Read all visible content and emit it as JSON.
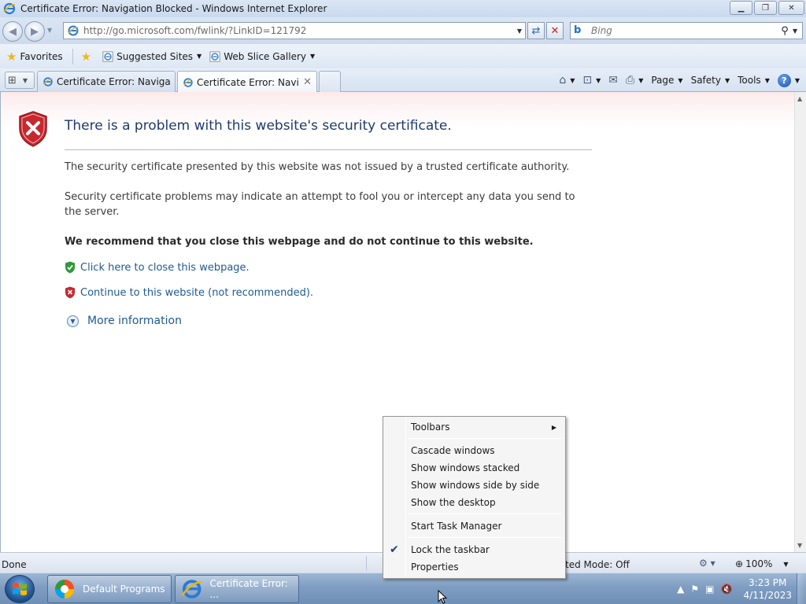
{
  "window": {
    "title": "Certificate Error: Navigation Blocked - Windows Internet Explorer"
  },
  "address_bar": {
    "url": "http://go.microsoft.com/fwlink/?LinkID=121792"
  },
  "search": {
    "placeholder": "Bing"
  },
  "favorites_bar": {
    "favorites_label": "Favorites",
    "suggested_sites": "Suggested Sites",
    "web_slice_gallery": "Web Slice Gallery"
  },
  "tabs": [
    {
      "label": "Certificate Error: Navigatio..."
    },
    {
      "label": "Certificate Error: Navig..."
    }
  ],
  "command_bar": {
    "page": "Page",
    "safety": "Safety",
    "tools": "Tools"
  },
  "page": {
    "heading": "There is a problem with this website's security certificate.",
    "para1": "The security certificate presented by this website was not issued by a trusted certificate authority.",
    "para2": "Security certificate problems may indicate an attempt to fool you or intercept any data you send to the server.",
    "recommend": "We recommend that you close this webpage and do not continue to this website.",
    "close_link": "Click here to close this webpage.",
    "continue_link": "Continue to this website (not recommended).",
    "more_info": "More information"
  },
  "status_bar": {
    "status": "Done",
    "protected_mode": "ted Mode: Off",
    "zoom": "100%"
  },
  "taskbar": {
    "buttons": [
      {
        "label": "Default Programs"
      },
      {
        "label": "Certificate Error: ..."
      }
    ],
    "time": "3:23 PM",
    "date": "4/11/2023"
  },
  "context_menu": {
    "items": [
      {
        "label": "Toolbars",
        "submenu": true
      },
      {
        "label": "Cascade windows"
      },
      {
        "label": "Show windows stacked"
      },
      {
        "label": "Show windows side by side"
      },
      {
        "label": "Show the desktop"
      },
      {
        "label": "Start Task Manager"
      },
      {
        "label": "Lock the taskbar",
        "checked": true
      },
      {
        "label": "Properties"
      }
    ]
  },
  "colors": {
    "heading": "#1e3a6b",
    "link": "#1e5a8f",
    "error_red": "#c8272e",
    "safe_green": "#2f9a3a"
  }
}
